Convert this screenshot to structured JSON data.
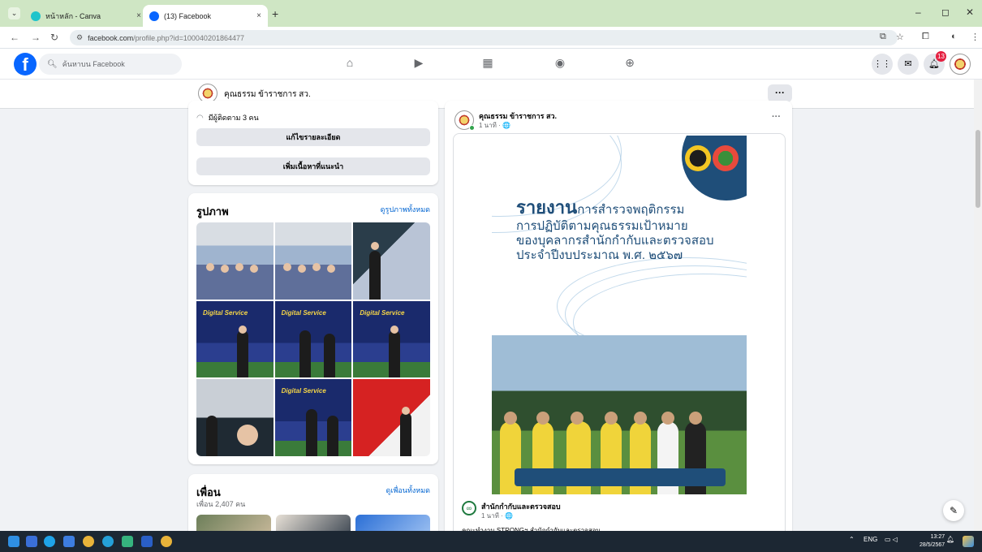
{
  "browser": {
    "tabs": [
      {
        "title": "หน้าหลัก - Canva",
        "active": false
      },
      {
        "title": "(13) Facebook",
        "active": true
      }
    ],
    "url_domain": "facebook.com",
    "url_path": "/profile.php?id=100040201864477",
    "new_tab": "+",
    "close_glyph": "×",
    "controls": {
      "minimize": "–",
      "restore": "◻",
      "close": "✕"
    }
  },
  "fb_header": {
    "logo": "f",
    "search_placeholder": "ค้นหาบน Facebook",
    "nav_icons": [
      "home-icon",
      "video-icon",
      "marketplace-icon",
      "groups-icon",
      "gaming-icon"
    ],
    "notification_count": "13"
  },
  "profile": {
    "name": "คุณธรรม ข้าราชการ สว.",
    "more_label": "···"
  },
  "intro": {
    "followers": "มีผู้ติดตาม 3 คน",
    "edit_details": "แก้ไขรายละเอียด",
    "add_featured": "เพิ่มเนื้อหาที่แนะนำ"
  },
  "photos": {
    "title": "รูปภาพ",
    "see_all": "ดูรูปภาพทั้งหมด",
    "sign_text": "Digital Service"
  },
  "friends": {
    "title": "เพื่อน",
    "see_all": "ดูเพื่อนทั้งหมด",
    "count": "เพื่อน 2,407 คน"
  },
  "post": {
    "author": "คุณธรรม ข้าราชการ สว.",
    "time": "1 นาที · 🌐",
    "more": "···",
    "poster": {
      "headline_big": "รายงาน",
      "headline_rest": "การสำรวจพฤติกรรม",
      "lines": [
        "การปฏิบัติตามคุณธรรมเป้าหมาย",
        "ของบุคลากรสำนักกำกับและตรวจสอบ",
        "ประจำปีงบประมาณ พ.ศ. ๒๕๖๗"
      ]
    },
    "shared": {
      "name": "สำนักกำกับและตรวจสอบ",
      "time": "1 นาที · 🌐",
      "caption": "คณะทำงาน STRONGฯ สำนักกำกับและตรวจสอบ"
    }
  },
  "taskbar": {
    "lang": "ENG",
    "time": "13:27",
    "date": "28/5/2567"
  },
  "colors": {
    "facebook_blue": "#0866ff",
    "tab_strip": "#cfe6c4",
    "poster_navy": "#1f4e79",
    "taskbar": "#1c2733"
  }
}
